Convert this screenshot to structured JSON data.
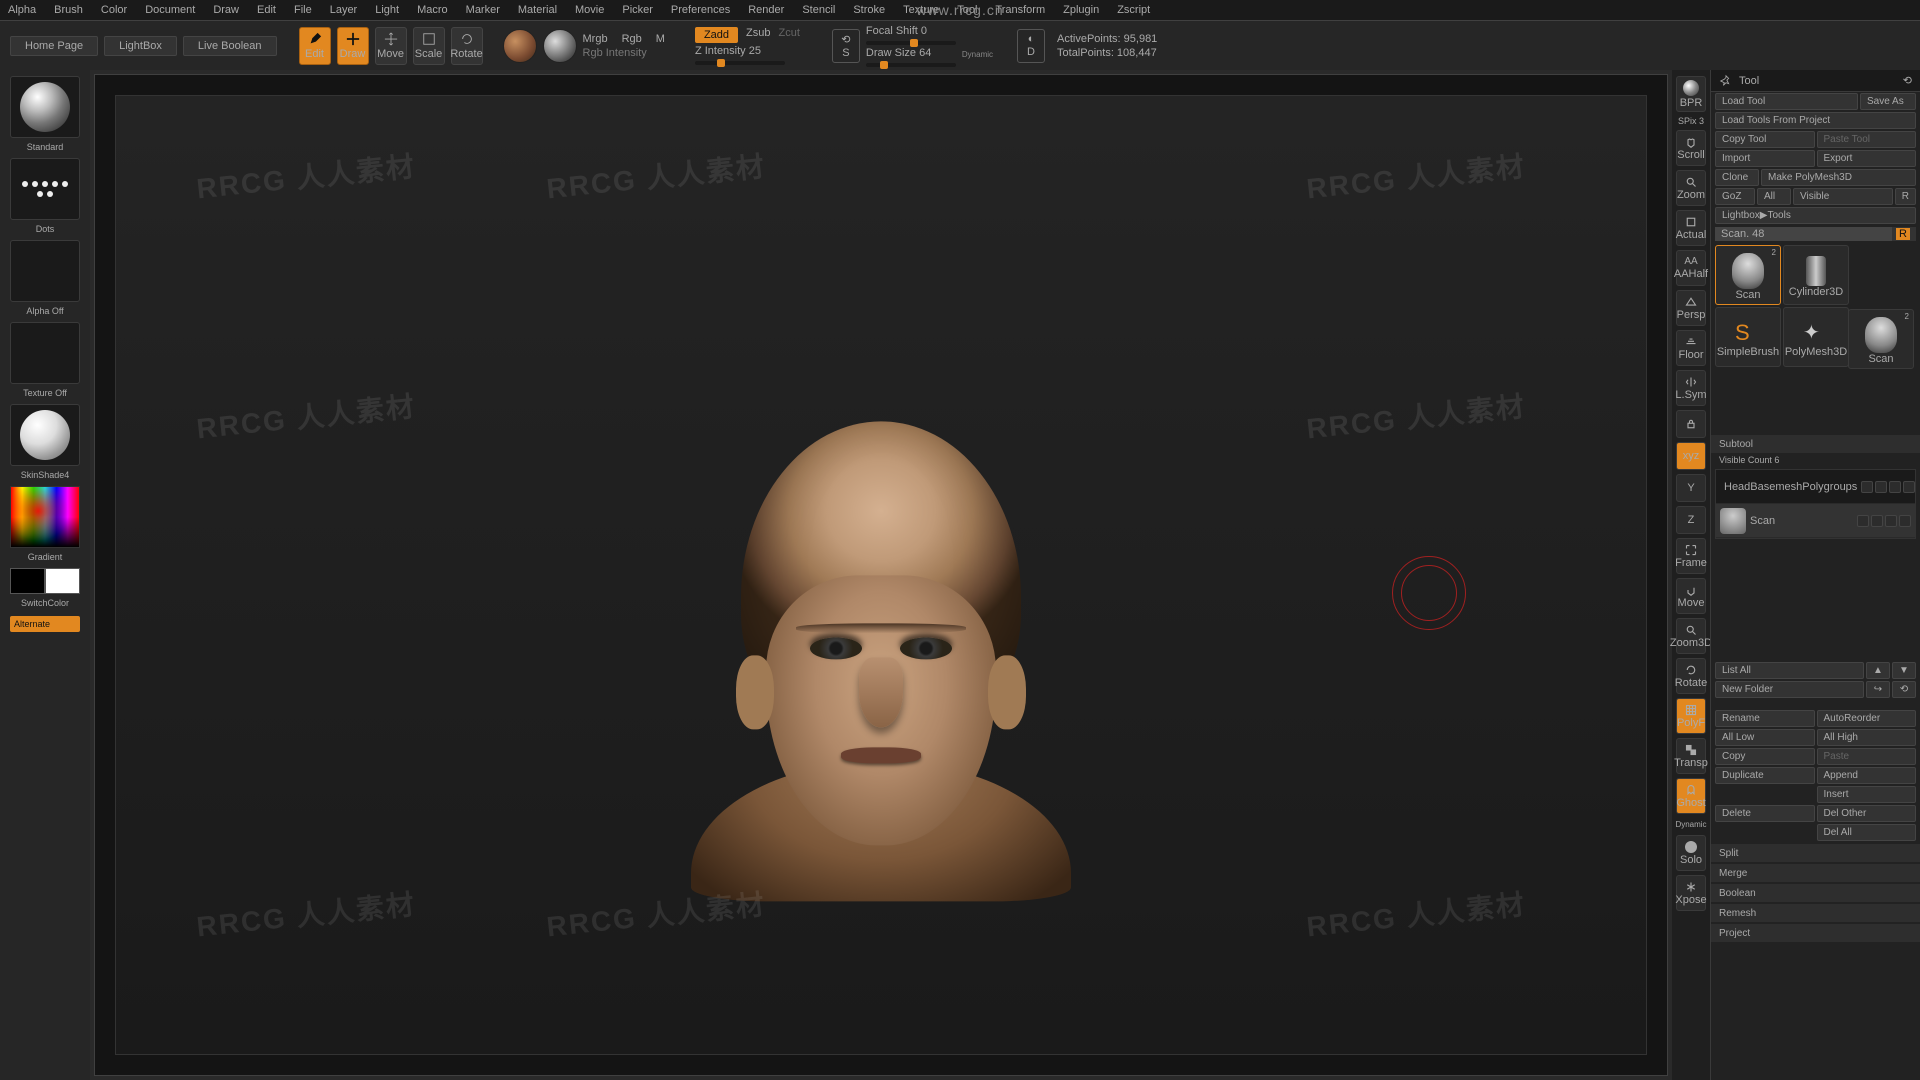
{
  "watermark_url": "www.rrcg.cn",
  "watermark_text": "RRCG 人人素材",
  "menu": [
    "Alpha",
    "Brush",
    "Color",
    "Document",
    "Draw",
    "Edit",
    "File",
    "Layer",
    "Light",
    "Macro",
    "Marker",
    "Material",
    "Movie",
    "Picker",
    "Preferences",
    "Render",
    "Stencil",
    "Stroke",
    "Texture",
    "Tool",
    "Transform",
    "Zplugin",
    "Zscript"
  ],
  "nav": {
    "home": "Home Page",
    "lightbox": "LightBox",
    "livebool": "Live Boolean"
  },
  "tools": {
    "edit": "Edit",
    "draw": "Draw",
    "move": "Move",
    "scale": "Scale",
    "rotate": "Rotate"
  },
  "rgb": {
    "mrgb": "Mrgb",
    "rgb": "Rgb",
    "m": "M",
    "intensity": "Rgb Intensity"
  },
  "z": {
    "zadd": "Zadd",
    "zsub": "Zsub",
    "zcut": "Zcut",
    "intensity": "Z Intensity 25"
  },
  "focal": {
    "shift": "Focal Shift 0",
    "size": "Draw Size 64",
    "dynamic": "Dynamic"
  },
  "stats": {
    "active": "ActivePoints: 95,981",
    "total": "TotalPoints: 108,447"
  },
  "left": {
    "brush": "Standard",
    "stroke": "Dots",
    "alpha": "Alpha Off",
    "texture": "Texture Off",
    "material": "SkinShade4",
    "gradient": "Gradient",
    "switch": "SwitchColor",
    "alternate": "Alternate"
  },
  "dock": {
    "bpr": "BPR",
    "spix": "SPix 3",
    "scroll": "Scroll",
    "zoom": "Zoom",
    "actual": "Actual",
    "aahalf": "AAHalf",
    "persp": "Persp",
    "floor": "Floor",
    "lsym": "L.Sym",
    "xyz": "xyz",
    "frame": "Frame",
    "move": "Move",
    "zoom3d": "Zoom3D",
    "rotate": "Rotate",
    "polyf": "PolyF",
    "transp": "Transp",
    "ghost": "Ghost",
    "dynamic": "Dynamic",
    "solo": "Solo",
    "xpose": "Xpose"
  },
  "tool": {
    "title": "Tool",
    "load": "Load Tool",
    "saveas": "Save As",
    "loadproj": "Load Tools From Project",
    "copy": "Copy Tool",
    "paste": "Paste Tool",
    "import": "Import",
    "export": "Export",
    "clone": "Clone",
    "makepoly": "Make PolyMesh3D",
    "goz": "GoZ",
    "all": "All",
    "visible": "Visible",
    "r": "R",
    "lightbox": "Lightbox▶Tools",
    "scan": "Scan. 48",
    "thumbs": [
      {
        "name": "Scan",
        "n": "2"
      },
      {
        "name": "Cylinder3D",
        "n": ""
      },
      {
        "name": "SimpleBrush",
        "n": ""
      },
      {
        "name": "PolyMesh3D",
        "n": ""
      },
      {
        "name": "Scan",
        "n": "2"
      }
    ],
    "subtool": "Subtool",
    "visiblecount": "Visible Count 6",
    "items": [
      "HeadBasemeshPolygroups",
      "Scan"
    ],
    "listall": "List All",
    "newfolder": "New Folder",
    "rename": "Rename",
    "autoreorder": "AutoReorder",
    "alllow": "All Low",
    "allhigh": "All High",
    "copy2": "Copy",
    "paste2": "Paste",
    "duplicate": "Duplicate",
    "append": "Append",
    "insert": "Insert",
    "delete": "Delete",
    "delother": "Del Other",
    "delall": "Del All",
    "split": "Split",
    "merge": "Merge",
    "boolean": "Boolean",
    "remesh": "Remesh",
    "project": "Project"
  }
}
